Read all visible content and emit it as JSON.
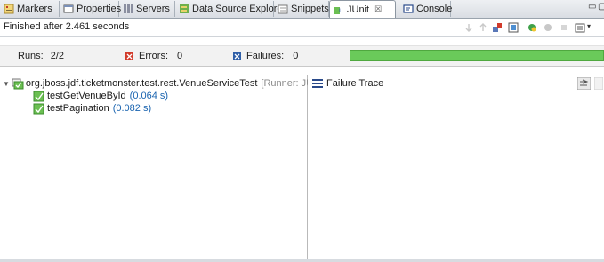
{
  "tabs": [
    {
      "label": "Markers",
      "icon": "markers-icon"
    },
    {
      "label": "Properties",
      "icon": "properties-icon"
    },
    {
      "label": "Servers",
      "icon": "servers-icon"
    },
    {
      "label": "Data Source Explorer",
      "icon": "data-source-icon"
    },
    {
      "label": "Snippets",
      "icon": "snippets-icon"
    },
    {
      "label": "JUnit",
      "icon": "junit-icon",
      "active": true,
      "close_glyph": "☒"
    },
    {
      "label": "Console",
      "icon": "console-icon"
    }
  ],
  "status": "Finished after 2.461 seconds",
  "counters": {
    "runs_label": "Runs:",
    "runs_value": "2/2",
    "errors_label": "Errors:",
    "errors_value": "0",
    "failures_label": "Failures:",
    "failures_value": "0"
  },
  "progress": 1.0,
  "colors": {
    "success": "#6aca5a",
    "error": "#d23b2b",
    "failure": "#2f5fa8",
    "time": "#1a64b0"
  },
  "tree": {
    "suite": {
      "label": "org.jboss.jdf.ticketmonster.test.rest.VenueServiceTest",
      "runner": "[Runner: JUnit"
    },
    "tests": [
      {
        "label": "testGetVenueById",
        "time": "(0.064 s)"
      },
      {
        "label": "testPagination",
        "time": "(0.082 s)"
      }
    ]
  },
  "failure_trace": {
    "title": "Failure Trace",
    "icon": "list-icon"
  }
}
